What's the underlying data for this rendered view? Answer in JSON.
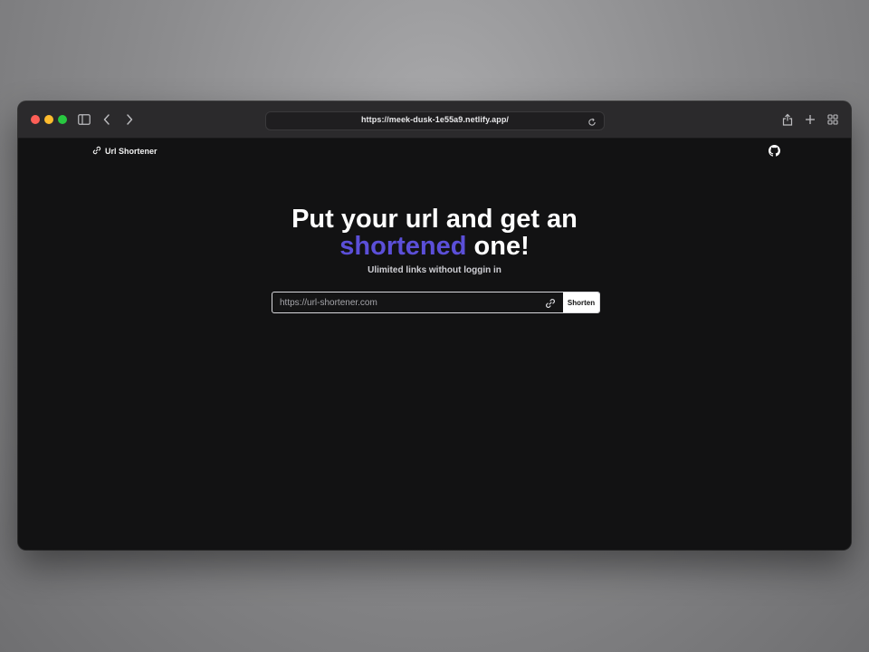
{
  "browser": {
    "url": "https://meek-dusk-1e55a9.netlify.app/",
    "icons": [
      "sidebar-icon",
      "back-icon",
      "forward-icon",
      "reload-icon",
      "share-icon",
      "new-tab-icon",
      "tab-overview-icon"
    ]
  },
  "header": {
    "brand_label": "Url Shortener",
    "brand_icon": "link-icon",
    "github_icon": "github-icon"
  },
  "hero": {
    "title_line1": "Put your url and get an",
    "title_accent": "shortened",
    "title_end": " one!",
    "subtitle": "Ulimited links without loggin in",
    "accent_color": "#5b4fd8"
  },
  "form": {
    "input_placeholder": "https://url-shortener.com",
    "input_value": "",
    "submit_label": "Shorten"
  }
}
